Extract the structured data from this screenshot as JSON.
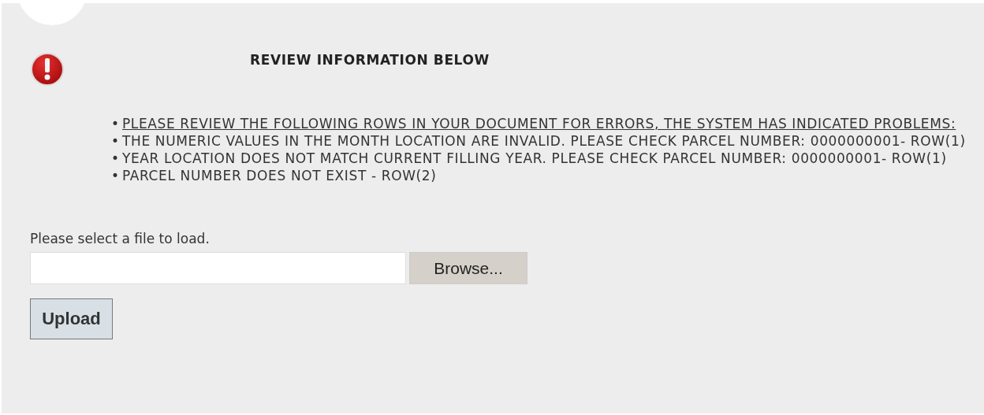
{
  "notice": {
    "title": "REVIEW INFORMATION BELOW"
  },
  "messages": [
    {
      "kind": "heading",
      "bullet": "•",
      "text": "PLEASE REVIEW THE FOLLOWING ROWS IN YOUR DOCUMENT FOR ERRORS, THE SYSTEM HAS INDICATED PROBLEMS:"
    },
    {
      "kind": "error",
      "bullet": "•",
      "text": "THE NUMERIC VALUES IN THE MONTH LOCATION ARE INVALID. PLEASE CHECK PARCEL NUMBER: 0000000001- ROW(1)"
    },
    {
      "kind": "error",
      "bullet": "•",
      "text": "YEAR LOCATION DOES NOT MATCH CURRENT FILLING YEAR. PLEASE CHECK PARCEL NUMBER: 0000000001- ROW(1)"
    },
    {
      "kind": "error",
      "bullet": "•",
      "text": "PARCEL NUMBER DOES NOT EXIST - ROW(2)"
    }
  ],
  "upload": {
    "label": "Please select a file to load.",
    "browse": "Browse...",
    "submit": "Upload"
  }
}
